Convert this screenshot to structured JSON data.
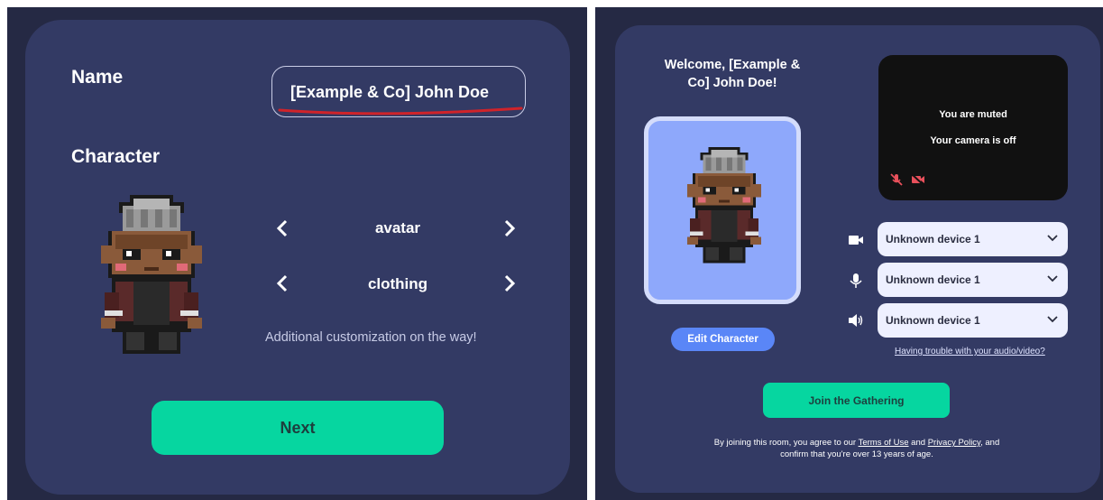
{
  "left": {
    "name_label": "Name",
    "name_value": "[Example & Co] John Doe",
    "character_label": "Character",
    "options": [
      {
        "label": "avatar"
      },
      {
        "label": "clothing"
      }
    ],
    "hint": "Additional customization on the way!",
    "next_label": "Next"
  },
  "right": {
    "welcome_line1": "Welcome, [Example &",
    "welcome_line2": "Co] John Doe!",
    "edit_character": "Edit Character",
    "video": {
      "muted": "You are muted",
      "camera_off": "Your camera is off"
    },
    "devices": [
      {
        "icon": "camera-icon",
        "value": "Unknown device 1"
      },
      {
        "icon": "microphone-icon",
        "value": "Unknown device 1"
      },
      {
        "icon": "speaker-icon",
        "value": "Unknown device 1"
      }
    ],
    "trouble_link": "Having trouble with your audio/video?",
    "join_label": "Join the Gathering",
    "legal": {
      "part1": "By joining this room, you agree to our ",
      "terms": "Terms of Use",
      "part2": " and ",
      "privacy": "Privacy Policy",
      "part3": ", and confirm that you're over 13 years of age."
    }
  },
  "colors": {
    "card_bg": "#333a64",
    "frame_bg": "#252944",
    "accent_green": "#06d6a0",
    "edit_blue": "#5a86f7",
    "avatar_bg": "#8ea8fb",
    "underline_red": "#d0232a"
  }
}
